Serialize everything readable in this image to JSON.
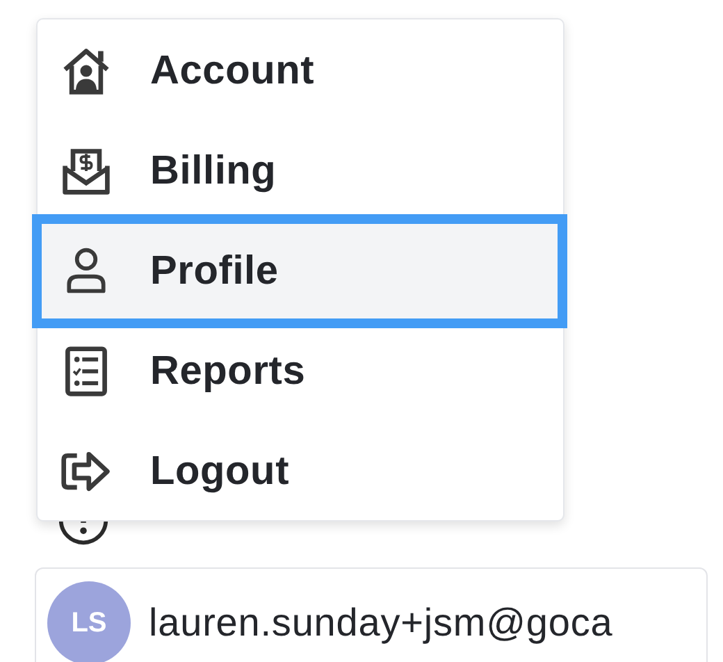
{
  "menu": {
    "items": [
      {
        "label": "Account",
        "selected": false
      },
      {
        "label": "Billing",
        "selected": false
      },
      {
        "label": "Profile",
        "selected": true
      },
      {
        "label": "Reports",
        "selected": false
      },
      {
        "label": "Logout",
        "selected": false
      }
    ]
  },
  "user": {
    "initials": "LS",
    "email": "lauren.sunday+jsm@goca"
  }
}
